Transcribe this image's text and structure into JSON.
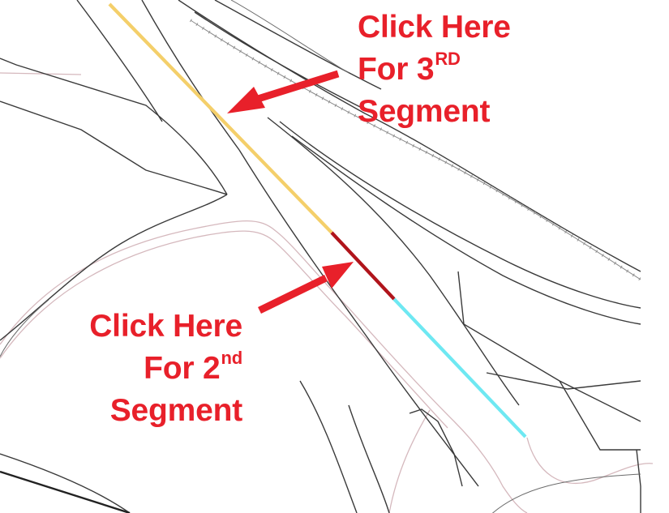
{
  "colors": {
    "annotation_red": "#e8202a",
    "segment_1": "#f4cf6a",
    "segment_2": "#b0141b",
    "segment_3": "#6ee8f2",
    "road_edge": "#3a3a3a",
    "road_edge_light": "#6b6b6b",
    "path_pink": "#d5b8bd",
    "background": "#ffffff"
  },
  "callouts": {
    "third": {
      "line1": "Click Here",
      "line2_main": "For 3",
      "line2_sup": "RD",
      "line3": "Segment"
    },
    "second": {
      "line1": "Click Here",
      "line2_main": "For 2",
      "line2_sup": "nd",
      "line3": "Segment"
    }
  },
  "map_features": {
    "segments": [
      "segment-yellow",
      "segment-red",
      "segment-cyan"
    ],
    "rail_line": "railroad-track",
    "arrows": [
      "arrow-to-3rd-segment",
      "arrow-to-2nd-segment"
    ]
  }
}
